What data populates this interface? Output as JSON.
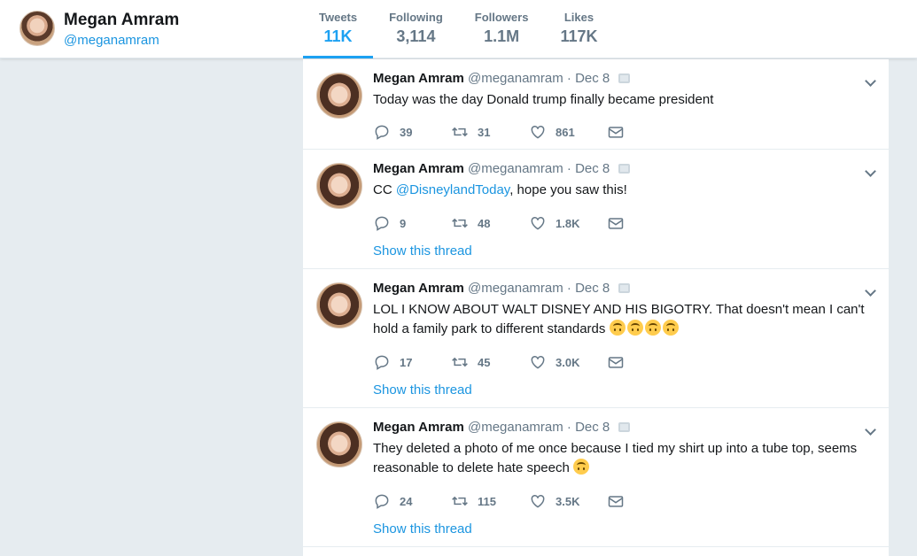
{
  "profile": {
    "name": "Megan Amram",
    "handle": "@meganamram"
  },
  "stats": [
    {
      "label": "Tweets",
      "value": "11K"
    },
    {
      "label": "Following",
      "value": "3,114"
    },
    {
      "label": "Followers",
      "value": "1.1M"
    },
    {
      "label": "Likes",
      "value": "117K"
    }
  ],
  "tweets": [
    {
      "name": "Megan Amram",
      "handle": "@meganamram",
      "dot": "·",
      "date": "Dec 8",
      "text": "Today was the day Donald trump finally became president",
      "replies": "39",
      "retweets": "31",
      "likes": "861"
    },
    {
      "name": "Megan Amram",
      "handle": "@meganamram",
      "dot": "·",
      "date": "Dec 8",
      "text_prefix": "CC ",
      "mention": "@DisneylandToday",
      "text_suffix": ", hope you saw this!",
      "replies": "9",
      "retweets": "48",
      "likes": "1.8K",
      "show_thread": "Show this thread"
    },
    {
      "name": "Megan Amram",
      "handle": "@meganamram",
      "dot": "·",
      "date": "Dec 8",
      "text": "LOL I KNOW ABOUT WALT DISNEY AND HIS BIGOTRY. That doesn't mean I can't hold a family park to different standards",
      "replies": "17",
      "retweets": "45",
      "likes": "3.0K",
      "show_thread": "Show this thread"
    },
    {
      "name": "Megan Amram",
      "handle": "@meganamram",
      "dot": "·",
      "date": "Dec 8",
      "text": "They deleted a photo of me once because I tied my shirt up into a tube top, seems reasonable to delete hate speech",
      "replies": "24",
      "retweets": "115",
      "likes": "3.5K",
      "show_thread": "Show this thread"
    }
  ],
  "icons": {
    "reply": "reply-icon",
    "retweet": "retweet-icon",
    "like": "heart-icon",
    "dm": "envelope-icon",
    "caret": "chevron-down-icon",
    "emoji": "upside-down-face-emoji"
  },
  "colors": {
    "accent": "#1da1f2",
    "link": "#1b95e0",
    "muted": "#657786",
    "background": "#e6ecf0"
  }
}
